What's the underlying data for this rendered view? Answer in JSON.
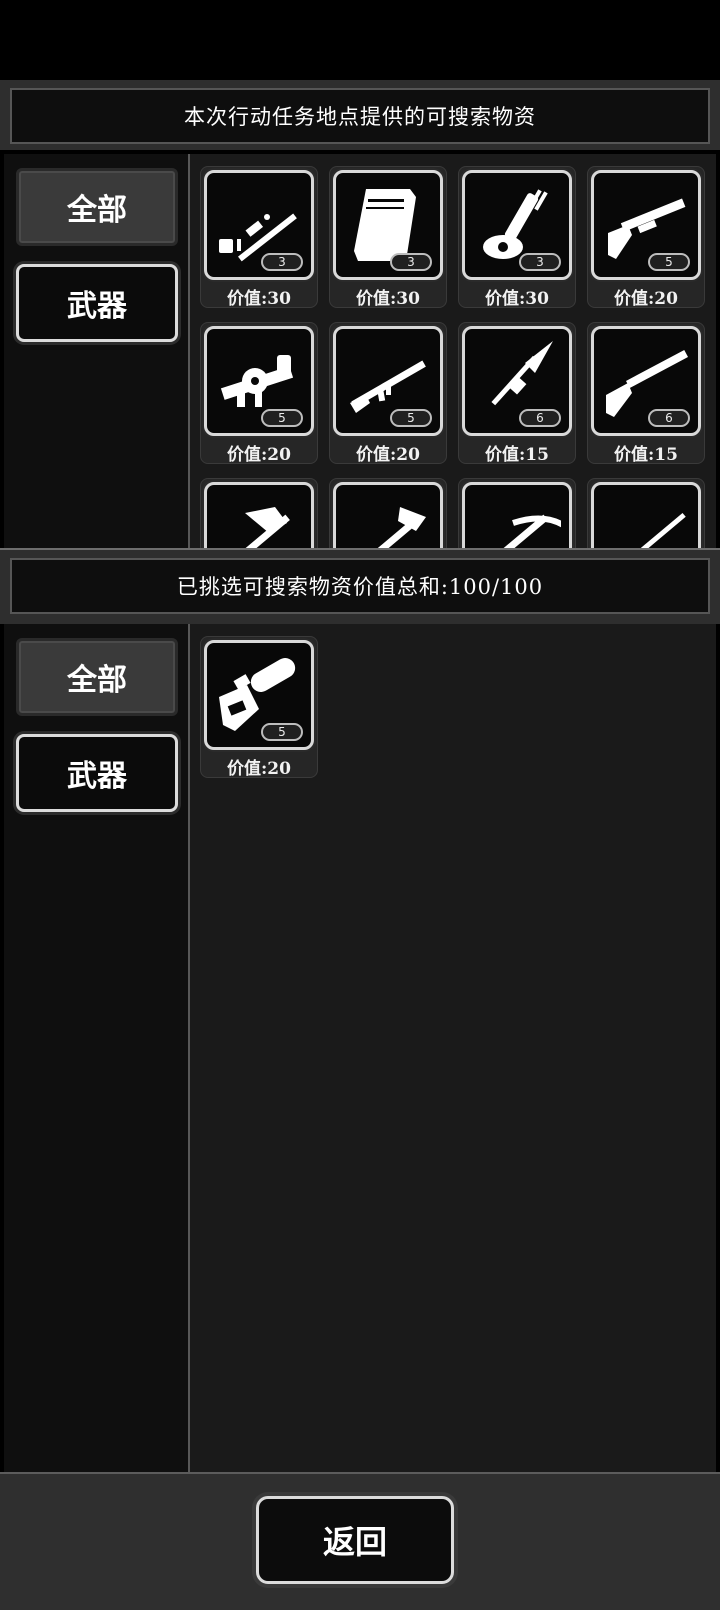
{
  "available": {
    "title": "本次行动任务地点提供的可搜索物资",
    "tabs": [
      {
        "label": "全部",
        "active": true
      },
      {
        "label": "武器",
        "active": false
      }
    ],
    "items": [
      {
        "icon": "sniper-rifle-icon",
        "count": "3",
        "price": "价值:30"
      },
      {
        "icon": "supply-case-icon",
        "count": "3",
        "price": "价值:30"
      },
      {
        "icon": "minigun-icon",
        "count": "3",
        "price": "价值:30"
      },
      {
        "icon": "shotgun-icon",
        "count": "5",
        "price": "价值:20"
      },
      {
        "icon": "grenade-launcher-icon",
        "count": "5",
        "price": "价值:20"
      },
      {
        "icon": "assault-rifle-icon",
        "count": "5",
        "price": "价值:20"
      },
      {
        "icon": "spear-icon",
        "count": "6",
        "price": "价值:15"
      },
      {
        "icon": "double-barrel-shotgun-icon",
        "count": "6",
        "price": "价值:15"
      },
      {
        "icon": "axe-icon",
        "count": "",
        "price": ""
      },
      {
        "icon": "hammer-icon",
        "count": "",
        "price": ""
      },
      {
        "icon": "crossbow-icon",
        "count": "",
        "price": ""
      },
      {
        "icon": "bolt-action-rifle-icon",
        "count": "",
        "price": ""
      }
    ]
  },
  "selected": {
    "title": "已挑选可搜索物资价值总和:100/100",
    "tabs": [
      {
        "label": "全部",
        "active": true
      },
      {
        "label": "武器",
        "active": false
      }
    ],
    "items": [
      {
        "icon": "chainsaw-icon",
        "count": "5",
        "price": "价值:20"
      }
    ]
  },
  "footer": {
    "back_label": "返回"
  }
}
